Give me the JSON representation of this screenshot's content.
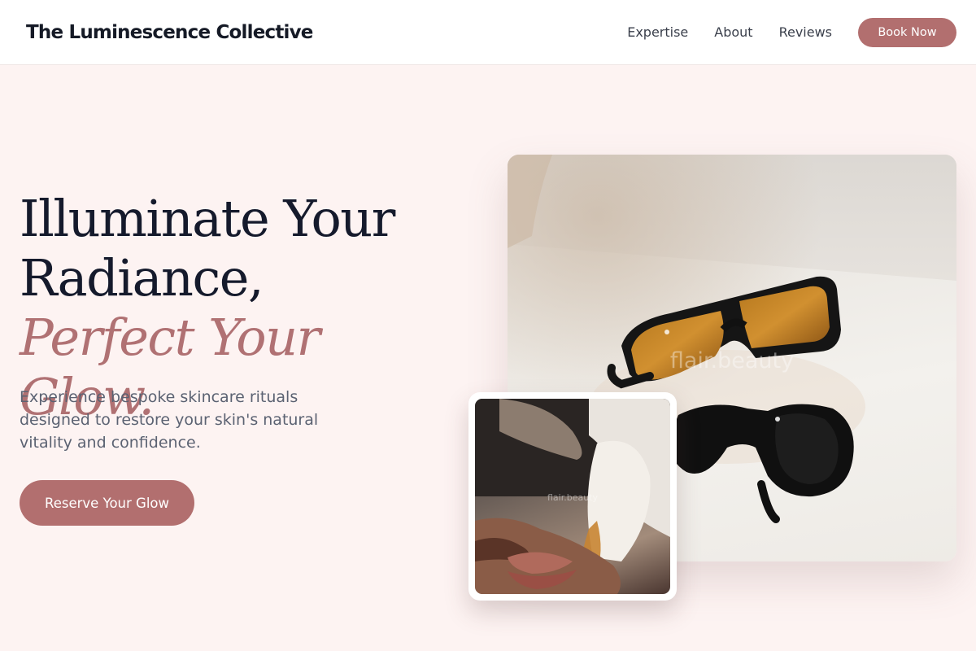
{
  "header": {
    "brand": "The Luminescence Collective",
    "nav": [
      {
        "label": "Expertise"
      },
      {
        "label": "About"
      },
      {
        "label": "Reviews"
      }
    ],
    "book_label": "Book Now"
  },
  "hero": {
    "title_line1": "Illuminate Your",
    "title_line2": "Radiance,",
    "title_accent": "Perfect Your Glow.",
    "subtitle": "Experience bespoke skincare rituals designed to restore your skin's natural vitality and confidence.",
    "cta_label": "Reserve Your Glow"
  },
  "images": {
    "main_watermark": "flair.beauty",
    "inset_watermark": "flair.beauty"
  },
  "colors": {
    "accent": "#b26f6f",
    "page_bg": "#fdf3f2",
    "heading": "#151a2c"
  }
}
